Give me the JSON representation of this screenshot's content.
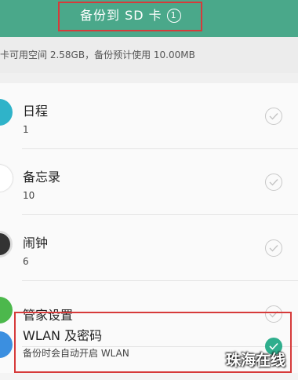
{
  "header": {
    "title": "备份到 SD 卡",
    "badge": "1",
    "bg_color": "#4aa88a",
    "highlight_color": "#d63a3a"
  },
  "info": {
    "text": "卡可用空间 2.58GB，备份预计使用 10.00MB"
  },
  "items": [
    {
      "title": "日程",
      "subtitle": "1",
      "icon": "calendar-icon",
      "checked": false
    },
    {
      "title": "备忘录",
      "subtitle": "10",
      "icon": "memo-icon",
      "checked": false
    },
    {
      "title": "闹钟",
      "subtitle": "6",
      "icon": "alarm-clock-icon",
      "checked": false
    },
    {
      "title": "管家设置",
      "subtitle": "",
      "icon": "phone-manager-icon",
      "checked": false
    },
    {
      "title": "WLAN 及密码",
      "subtitle": "备份时会自动开启 WLAN",
      "icon": "wlan-icon",
      "checked": true
    }
  ],
  "accent_color": "#2fae8d",
  "watermark": "珠海在线"
}
